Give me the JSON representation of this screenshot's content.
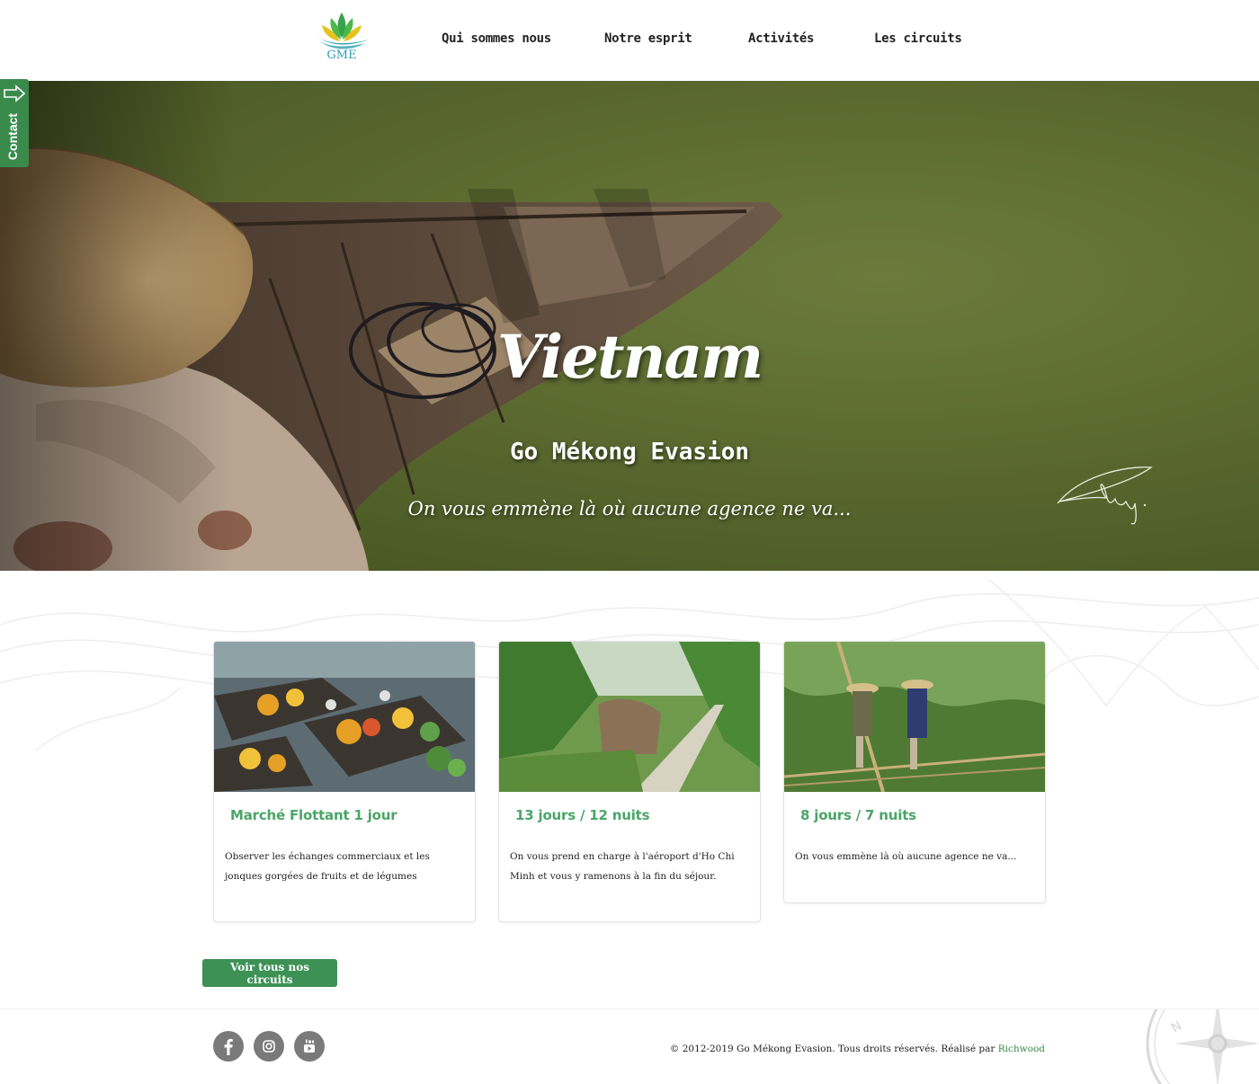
{
  "header": {
    "logo_text": "GME",
    "nav": [
      "Qui sommes nous",
      "Notre esprit",
      "Activités",
      "Les circuits"
    ]
  },
  "contact_tab": {
    "label": "Contact"
  },
  "hero": {
    "title": "Vietnam",
    "subtitle": "Go Mékong Evasion",
    "tagline": "On vous emmène là où aucune agence ne va..."
  },
  "cards": [
    {
      "title": "Marché Flottant 1 jour",
      "description": "Observer les échanges commerciaux et les jonques gorgées de fruits et de légumes"
    },
    {
      "title": "13 jours / 12 nuits",
      "description": "On vous prend en charge à l'aéroport d'Ho Chi Minh et vous y ramenons à la fin du séjour."
    },
    {
      "title": "8 jours / 7 nuits",
      "description": "On vous emmène là où aucune agence ne va..."
    }
  ],
  "cta": {
    "label": "Voir tous nos circuits"
  },
  "footer": {
    "social": [
      "facebook-icon",
      "instagram-icon",
      "youtube-icon"
    ],
    "copyright": "© 2012-2019 Go Mékong Evasion. Tous droits réservés. Réalisé par",
    "credit_link": "Richwood"
  },
  "colors": {
    "accent": "#3e9155",
    "card_title": "#4aa567",
    "hero_green": "#5a6830",
    "logo_teal": "#2e9fb3"
  }
}
